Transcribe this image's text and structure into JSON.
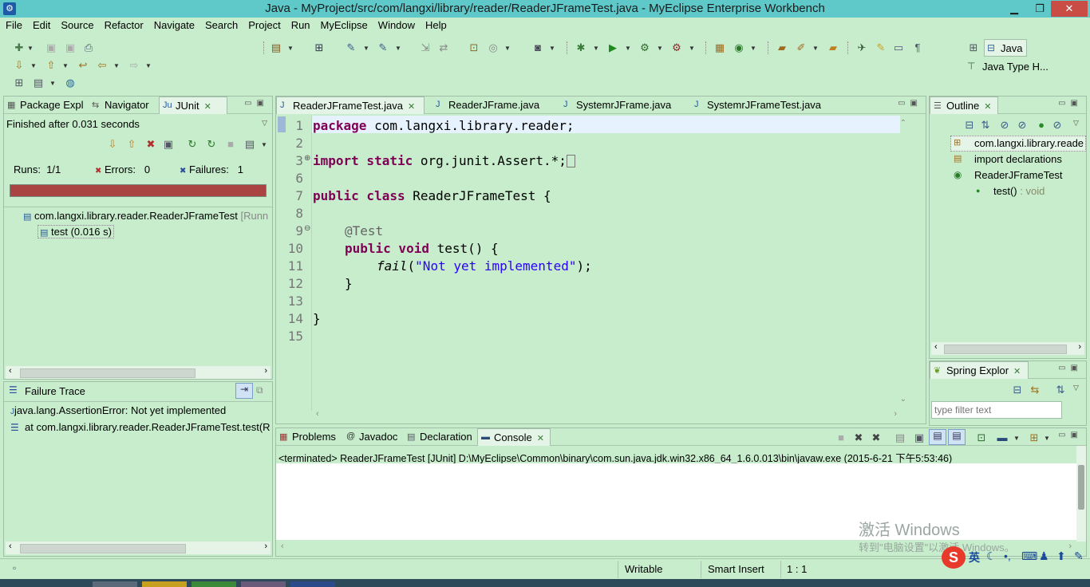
{
  "window": {
    "title": "Java - MyProject/src/com/langxi/library/reader/ReaderJFrameTest.java - MyEclipse Enterprise Workbench",
    "minimize": "▁",
    "restore": "❐",
    "close": "✕"
  },
  "menu": [
    "File",
    "Edit",
    "Source",
    "Refactor",
    "Navigate",
    "Search",
    "Project",
    "Run",
    "MyEclipse",
    "Window",
    "Help"
  ],
  "perspective": {
    "active": "Java",
    "other": "Java Type H..."
  },
  "left_panel": {
    "tabs": [
      "Package Expl",
      "Navigator",
      "JUnit"
    ],
    "status": "Finished after 0.031 seconds",
    "runs_label": "Runs:",
    "runs_value": "1/1",
    "errors_label": "Errors:",
    "errors_value": "0",
    "failures_label": "Failures:",
    "failures_value": "1",
    "progress_color": "#a94442",
    "progress": 1.0,
    "tree": {
      "suite": "com.langxi.library.reader.ReaderJFrameTest",
      "suite_runner": "[Runn",
      "test": "test (0.016 s)"
    },
    "failure_trace_title": "Failure Trace",
    "trace": [
      "java.lang.AssertionError: Not yet implemented",
      "at com.langxi.library.reader.ReaderJFrameTest.test(R"
    ]
  },
  "editor": {
    "tabs": [
      "ReaderJFrameTest.java",
      "ReaderJFrame.java",
      "SystemrJFrame.java",
      "SystemrJFrameTest.java"
    ],
    "line_numbers": [
      "1",
      "2",
      "3",
      "6",
      "7",
      "8",
      "9",
      "10",
      "11",
      "12",
      "13",
      "14",
      "15"
    ],
    "code": {
      "l1_kw": "package",
      "l1_rest": " com.langxi.library.reader;",
      "l3_kw": "import static",
      "l3_rest": " org.junit.Assert.*;",
      "l7_kw": "public class",
      "l7_rest": " ReaderJFrameTest {",
      "l9_ann": "@Test",
      "l10_kw": "public void",
      "l10_rest": " test() {",
      "l11_fn": "fail",
      "l11_open": "(",
      "l11_str": "\"Not yet implemented\"",
      "l11_close": ");",
      "l12": "}",
      "l14": "}"
    }
  },
  "outline": {
    "tab": "Outline",
    "items": [
      "com.langxi.library.reade",
      "import declarations",
      "ReaderJFrameTest",
      "test()"
    ],
    "test_type": ": void"
  },
  "spring": {
    "tab": "Spring Explor",
    "filter_placeholder": "type filter text"
  },
  "bottom": {
    "tabs": [
      "Problems",
      "Javadoc",
      "Declaration",
      "Console"
    ],
    "console_header": "<terminated> ReaderJFrameTest [JUnit] D:\\MyEclipse\\Common\\binary\\com.sun.java.jdk.win32.x86_64_1.6.0.013\\bin\\javaw.exe (2015-6-21 下午5:53:46)"
  },
  "status": {
    "writable": "Writable",
    "insert": "Smart Insert",
    "position": "1 : 1"
  },
  "watermark": {
    "line1": "激活 Windows",
    "line2": "转到\"电脑设置\"以激活 Windows。"
  },
  "ime": "英"
}
